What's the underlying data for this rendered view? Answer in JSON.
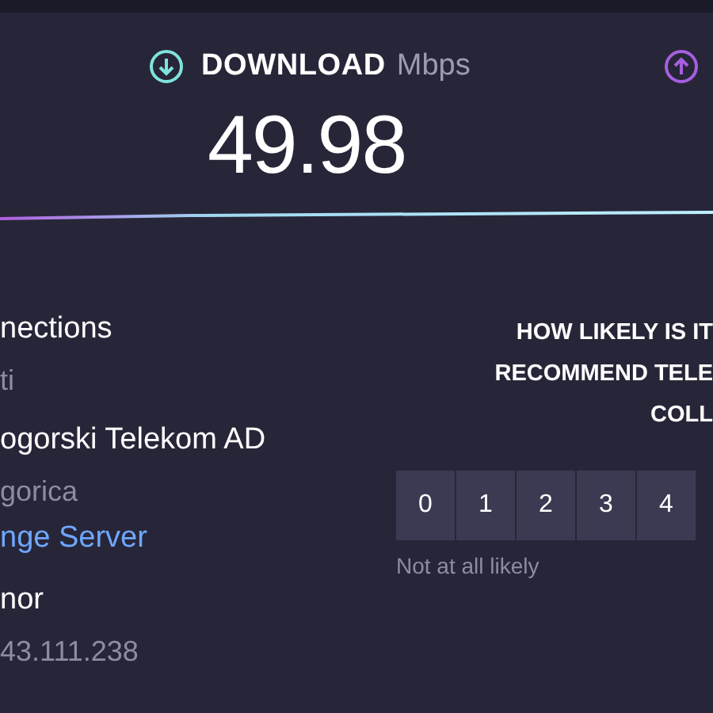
{
  "download": {
    "label": "DOWNLOAD",
    "unit": "Mbps",
    "speed": "49.98"
  },
  "connection_info": [
    {
      "kind": "heading",
      "text": "nections"
    },
    {
      "kind": "detail",
      "text": "ti"
    },
    {
      "kind": "heading",
      "text": "ogorski Telekom AD"
    },
    {
      "kind": "detail",
      "text": "gorica"
    },
    {
      "kind": "link",
      "text": "nge Server"
    },
    {
      "kind": "heading",
      "text": "nor"
    },
    {
      "kind": "detail",
      "text": "43.111.238"
    }
  ],
  "survey": {
    "question_lines": [
      "HOW LIKELY IS IT",
      "RECOMMEND TELE",
      "COLL"
    ],
    "options": [
      "0",
      "1",
      "2",
      "3",
      "4"
    ],
    "low_label": "Not at all likely"
  }
}
